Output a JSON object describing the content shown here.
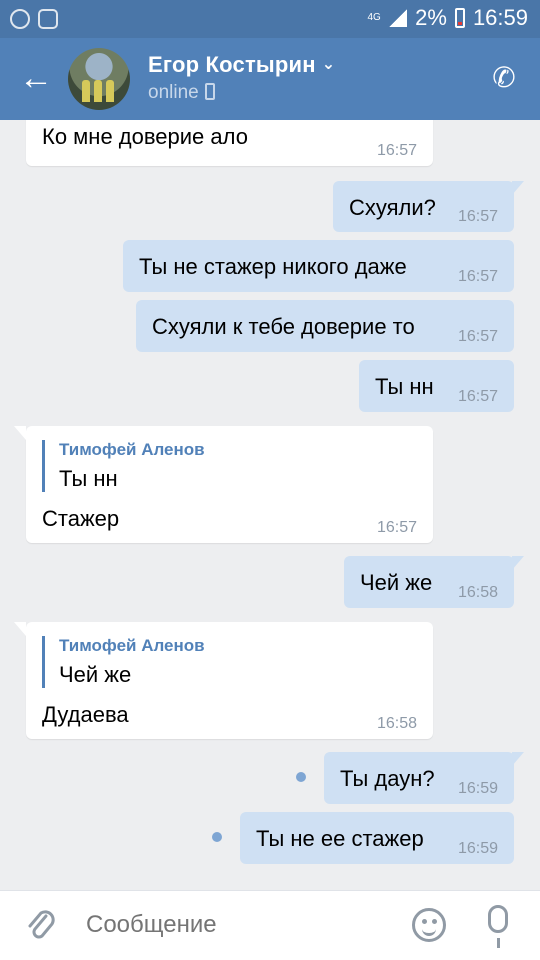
{
  "status_bar": {
    "network": "4G",
    "battery": "2%",
    "time": "16:59"
  },
  "header": {
    "contact_name": "Егор Костырин",
    "presence": "online"
  },
  "messages": [
    {
      "id": 1,
      "direction": "in",
      "text": "Ко мне доверие ало",
      "time": "16:57"
    },
    {
      "id": 2,
      "direction": "out",
      "text": "Схуяли?",
      "time": "16:57"
    },
    {
      "id": 3,
      "direction": "out",
      "text": "Ты не стажер никого даже",
      "time": "16:57"
    },
    {
      "id": 4,
      "direction": "out",
      "text": "Схуяли к тебе доверие то",
      "time": "16:57"
    },
    {
      "id": 5,
      "direction": "out",
      "text": "Ты нн",
      "time": "16:57"
    },
    {
      "id": 6,
      "direction": "in",
      "reply_author": "Тимофей Аленов",
      "reply_text": "Ты нн",
      "text": "Стажер",
      "time": "16:57"
    },
    {
      "id": 7,
      "direction": "out",
      "text": "Чей же",
      "time": "16:58"
    },
    {
      "id": 8,
      "direction": "in",
      "reply_author": "Тимофей Аленов",
      "reply_text": "Чей же",
      "text": "Дудаева",
      "time": "16:58"
    },
    {
      "id": 9,
      "direction": "out",
      "text": "Ты даун?",
      "time": "16:59",
      "unread": true
    },
    {
      "id": 10,
      "direction": "out",
      "text": "Ты не ее стажер",
      "time": "16:59",
      "unread": true
    }
  ],
  "composer": {
    "placeholder": "Сообщение"
  },
  "colors": {
    "header": "#5181b8",
    "statusbar": "#4a76a8",
    "outgoing": "#cfe0f3",
    "incoming": "#ffffff",
    "background": "#edeef0"
  }
}
